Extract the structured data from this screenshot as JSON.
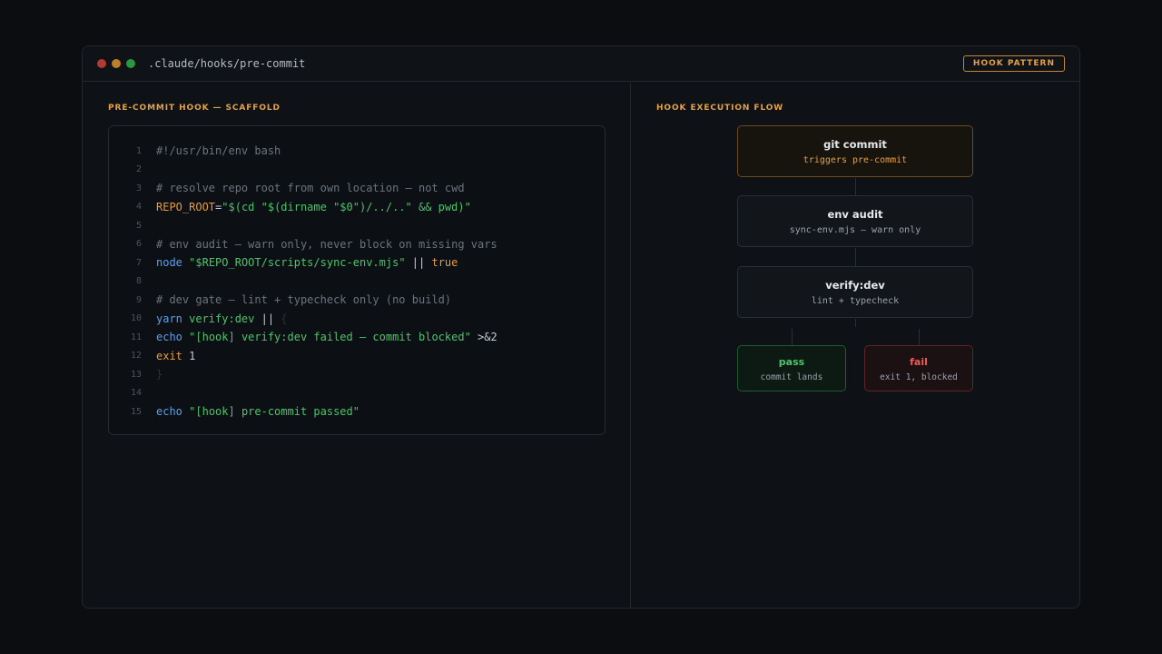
{
  "window": {
    "path": ".claude/hooks/pre-commit",
    "badge": "HOOK PATTERN"
  },
  "left_panel": {
    "label": "PRE-COMMIT HOOK — SCAFFOLD",
    "code_lines": [
      {
        "n": "1",
        "tokens": [
          {
            "t": "#!/usr/bin/env bash",
            "c": "comment"
          }
        ]
      },
      {
        "n": "2",
        "tokens": []
      },
      {
        "n": "3",
        "tokens": [
          {
            "t": "# resolve repo root from own location — not cwd",
            "c": "comment"
          }
        ]
      },
      {
        "n": "4",
        "tokens": [
          {
            "t": "REPO_ROOT",
            "c": "var"
          },
          {
            "t": "=",
            "c": "plain"
          },
          {
            "t": "\"$(cd \"$(dirname \"$0\")/../..\" && pwd)\"",
            "c": "str"
          }
        ]
      },
      {
        "n": "5",
        "tokens": []
      },
      {
        "n": "6",
        "tokens": [
          {
            "t": "# env audit — warn only, never block on missing vars",
            "c": "comment"
          }
        ]
      },
      {
        "n": "7",
        "tokens": [
          {
            "t": "node",
            "c": "cmd"
          },
          {
            "t": " ",
            "c": "plain"
          },
          {
            "t": "\"$REPO_ROOT/scripts/sync-env.mjs\"",
            "c": "str"
          },
          {
            "t": " || ",
            "c": "plain"
          },
          {
            "t": "true",
            "c": "kw"
          }
        ]
      },
      {
        "n": "8",
        "tokens": []
      },
      {
        "n": "9",
        "tokens": [
          {
            "t": "# dev gate — lint + typecheck only (no build)",
            "c": "comment"
          }
        ]
      },
      {
        "n": "10",
        "tokens": [
          {
            "t": "yarn",
            "c": "cmd"
          },
          {
            "t": " verify:dev",
            "c": "str"
          },
          {
            "t": " || ",
            "c": "plain"
          },
          {
            "t": "{",
            "c": "dim"
          }
        ]
      },
      {
        "n": "11",
        "tokens": [
          {
            "t": "echo",
            "c": "cmd"
          },
          {
            "t": " ",
            "c": "plain"
          },
          {
            "t": "\"[hook] verify:dev failed — commit blocked\"",
            "c": "str"
          },
          {
            "t": " >&2",
            "c": "plain"
          }
        ]
      },
      {
        "n": "12",
        "tokens": [
          {
            "t": "exit",
            "c": "kw"
          },
          {
            "t": " 1",
            "c": "plain"
          }
        ]
      },
      {
        "n": "13",
        "tokens": [
          {
            "t": "}",
            "c": "dim"
          }
        ]
      },
      {
        "n": "14",
        "tokens": []
      },
      {
        "n": "15",
        "tokens": [
          {
            "t": "echo",
            "c": "cmd"
          },
          {
            "t": " ",
            "c": "plain"
          },
          {
            "t": "\"[hook] pre-commit passed\"",
            "c": "str"
          }
        ]
      }
    ]
  },
  "right_panel": {
    "label": "HOOK EXECUTION FLOW",
    "nodes": {
      "git_commit": {
        "title": "git commit",
        "sub": "triggers pre-commit"
      },
      "env_audit": {
        "title": "env audit",
        "sub": "sync-env.mjs — warn only"
      },
      "verify_dev": {
        "title": "verify:dev",
        "sub": "lint + typecheck"
      },
      "pass": {
        "title": "pass",
        "sub": "commit lands"
      },
      "fail": {
        "title": "fail",
        "sub": "exit 1, blocked"
      }
    }
  },
  "colors": {
    "accent": "#e4a04a",
    "string": "#4fc36c",
    "command": "#5b9ff2",
    "error": "#ef5b55"
  }
}
